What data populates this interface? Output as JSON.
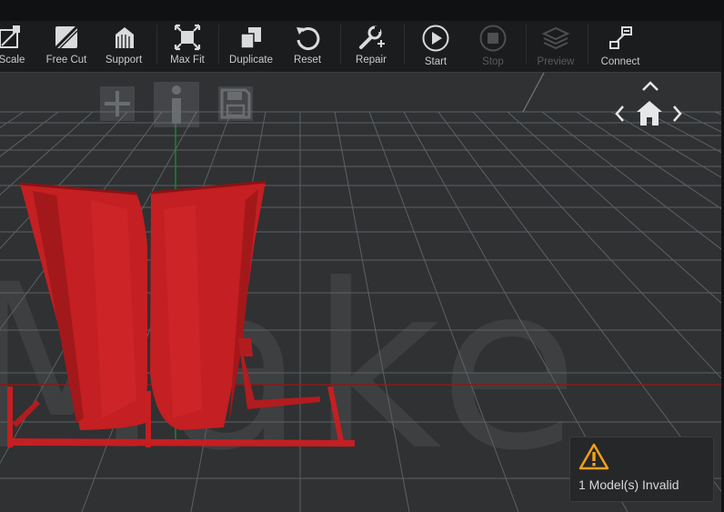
{
  "toolbar": {
    "items": [
      {
        "label": "Scale",
        "icon": "scale-icon"
      },
      {
        "label": "Free Cut",
        "icon": "free-cut-icon"
      },
      {
        "label": "Support",
        "icon": "support-icon"
      },
      {
        "label": "Max Fit",
        "icon": "max-fit-icon"
      },
      {
        "label": "Duplicate",
        "icon": "duplicate-icon"
      },
      {
        "label": "Reset",
        "icon": "reset-icon"
      },
      {
        "label": "Repair",
        "icon": "repair-icon"
      },
      {
        "label": "Start",
        "icon": "play-icon"
      },
      {
        "label": "Stop",
        "icon": "stop-icon",
        "disabled": true
      },
      {
        "label": "Preview",
        "icon": "layers-icon",
        "disabled": true
      },
      {
        "label": "Connect",
        "icon": "connect-icon"
      }
    ]
  },
  "viewport": {
    "watermark": "Make",
    "overlay_buttons": [
      {
        "name": "add-model-button",
        "icon": "plus-icon"
      },
      {
        "name": "info-button",
        "icon": "info-icon"
      },
      {
        "name": "save-button",
        "icon": "floppy-disk-icon"
      }
    ],
    "nav_cube": {
      "icons": [
        "up-arrow-icon",
        "left-arrow-icon",
        "home-icon",
        "right-arrow-icon"
      ]
    }
  },
  "warning": {
    "icon": "warning-icon",
    "text": "1 Model(s) Invalid"
  },
  "colors": {
    "model": "#c41f22",
    "toolbar_bg": "#1b1c1d",
    "viewport_bg": "#2f3133",
    "grid": "#5e6164",
    "x_axis": "#8a1a1a",
    "y_axis": "#1a8a2a",
    "warning_accent": "#f0a11a"
  }
}
